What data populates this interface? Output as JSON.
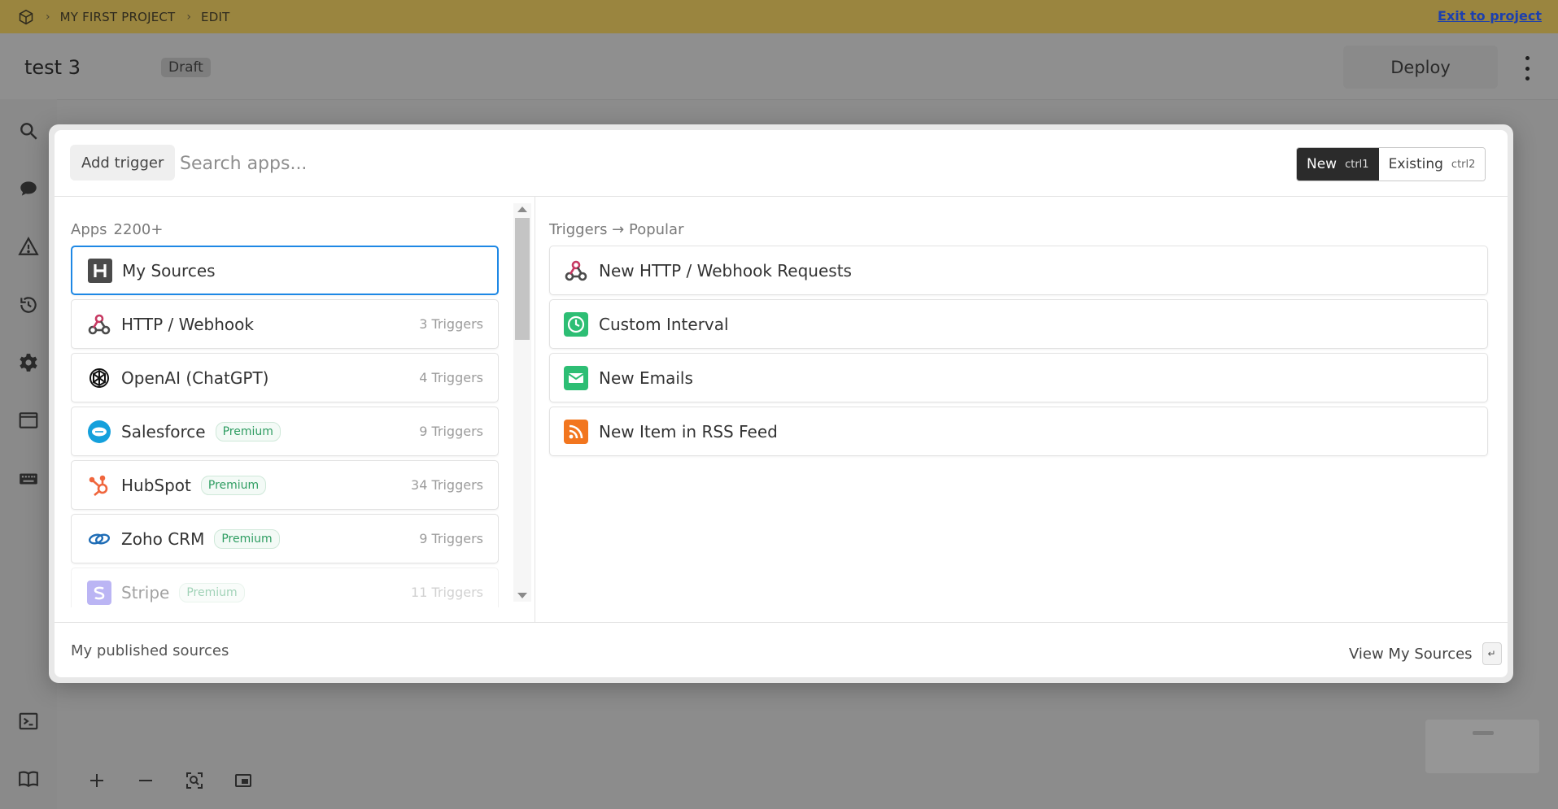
{
  "topbar": {
    "breadcrumb": [
      "MY FIRST PROJECT",
      "EDIT"
    ],
    "exit_label": "Exit to project",
    "background": "#9a853f"
  },
  "header": {
    "workflow_name": "test 3",
    "status_badge": "Draft",
    "deploy_label": "Deploy"
  },
  "rail": {
    "top_icons": [
      "search-icon",
      "chat-icon",
      "warning-icon",
      "history-icon",
      "gear-icon",
      "window-icon",
      "keyboard-icon"
    ],
    "bottom_icons": [
      "terminal-icon",
      "book-icon"
    ]
  },
  "canvas_tools": [
    "plus-icon",
    "minus-icon",
    "fit-view-icon",
    "minimap-toggle-icon"
  ],
  "modal": {
    "add_trigger_label": "Add trigger",
    "search_placeholder": "Search apps...",
    "mode": {
      "new_label": "New",
      "new_shortcut": "ctrl1",
      "existing_label": "Existing",
      "existing_shortcut": "ctrl2",
      "selected": "New"
    },
    "apps_section": {
      "title": "Apps",
      "count": "2200+"
    },
    "apps": [
      {
        "name": "My Sources",
        "icon": "my-sources-icon",
        "triggers": "",
        "premium": "",
        "selected": true
      },
      {
        "name": "HTTP / Webhook",
        "icon": "webhook-icon",
        "triggers": "3 Triggers",
        "premium": ""
      },
      {
        "name": "OpenAI (ChatGPT)",
        "icon": "openai-icon",
        "triggers": "4 Triggers",
        "premium": ""
      },
      {
        "name": "Salesforce",
        "icon": "salesforce-icon",
        "triggers": "9 Triggers",
        "premium": "Premium"
      },
      {
        "name": "HubSpot",
        "icon": "hubspot-icon",
        "triggers": "34 Triggers",
        "premium": "Premium"
      },
      {
        "name": "Zoho CRM",
        "icon": "zoho-icon",
        "triggers": "9 Triggers",
        "premium": "Premium"
      },
      {
        "name": "Stripe",
        "icon": "stripe-icon",
        "triggers": "11 Triggers",
        "premium": "Premium"
      }
    ],
    "triggers_section": {
      "title": "Triggers → Popular"
    },
    "triggers": [
      {
        "name": "New HTTP / Webhook Requests",
        "icon": "webhook-icon"
      },
      {
        "name": "Custom Interval",
        "icon": "clock-icon"
      },
      {
        "name": "New Emails",
        "icon": "email-icon"
      },
      {
        "name": "New Item in RSS Feed",
        "icon": "rss-icon"
      }
    ],
    "footer": {
      "published_label": "My published sources",
      "view_label": "View My Sources",
      "enter_key": "↵"
    }
  },
  "colors": {
    "selected_border": "#1e88e5",
    "premium_text": "#2f9d62",
    "active_segment": "#2b2b2b"
  }
}
